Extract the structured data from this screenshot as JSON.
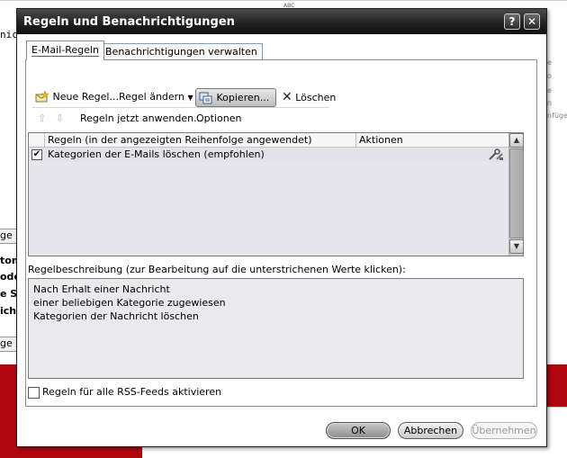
{
  "background": {
    "left_snippets": [
      "nic",
      "ge n",
      "tom",
      "ode",
      "e S",
      "icht",
      "ge"
    ],
    "abc": "ABC",
    "right_hints": [
      "e",
      "o",
      "e",
      "n",
      "nfüge"
    ]
  },
  "dialog": {
    "title": "Regeln und Benachrichtigungen",
    "help_label": "?",
    "close_label": "✕",
    "tabs": [
      {
        "label": "E-Mail-Regeln",
        "active": true
      },
      {
        "label": "Benachrichtigungen verwalten",
        "active": false
      }
    ],
    "toolbar": {
      "new_rule": "Neue Regel...",
      "change_rule": "Regel ändern",
      "copy": "Kopieren...",
      "delete": "Löschen",
      "apply_now": "Regeln jetzt anwenden...",
      "options": "Optionen"
    },
    "rules_list": {
      "columns": [
        "Regeln (in der angezeigten Reihenfolge angewendet)",
        "Aktionen"
      ],
      "rows": [
        {
          "checked": true,
          "name": "Kategorien der E-Mails löschen (empfohlen)"
        }
      ]
    },
    "description": {
      "label": "Regelbeschreibung (zur Bearbeitung auf die unterstrichenen Werte klicken):",
      "lines": [
        "Nach Erhalt einer Nachricht",
        "einer beliebigen Kategorie zugewiesen",
        "Kategorien der Nachricht löschen"
      ]
    },
    "rss_label": "Regeln für alle RSS-Feeds aktivieren",
    "buttons": {
      "ok": "OK",
      "cancel": "Abbrechen",
      "apply": "Übernehmen"
    }
  }
}
